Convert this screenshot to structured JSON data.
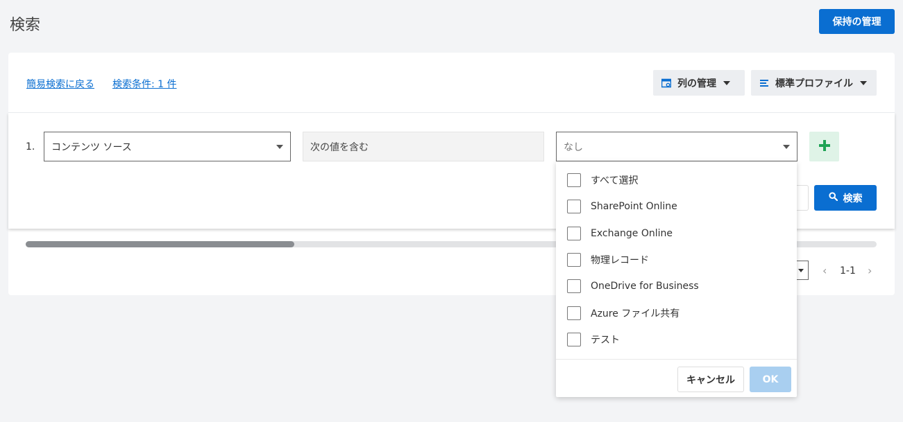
{
  "header": {
    "title": "検索",
    "manage_retention_label": "保持の管理"
  },
  "toolbar": {
    "back_to_simple_label": "簡易検索に戻る",
    "conditions_label": "検索条件: 1 件",
    "manage_columns_label": "列の管理",
    "profile_label": "標準プロファイル"
  },
  "condition": {
    "row_number": "1.",
    "field_value": "コンテンツ ソース",
    "operator_value": "次の値を含む",
    "value_placeholder": "なし"
  },
  "search_button_label": "検索",
  "dropdown": {
    "options": [
      {
        "label": "すべて選択",
        "checked": false
      },
      {
        "label": "SharePoint Online",
        "checked": false
      },
      {
        "label": "Exchange Online",
        "checked": false
      },
      {
        "label": "物理レコード",
        "checked": false
      },
      {
        "label": "OneDrive for Business",
        "checked": false
      },
      {
        "label": "Azure ファイル共有",
        "checked": false
      },
      {
        "label": "テスト",
        "checked": false
      }
    ],
    "cancel_label": "キャンセル",
    "ok_label": "OK"
  },
  "pager": {
    "range": "1-1",
    "prev_icon": "chevron-left-icon",
    "next_icon": "chevron-right-icon"
  },
  "scroll": {
    "position_fraction": 0.32
  },
  "colors": {
    "primary": "#0a6ed1",
    "ok_disabled": "#a9cff0",
    "add_bg": "#dff3e7",
    "add_icon": "#1ea354"
  }
}
